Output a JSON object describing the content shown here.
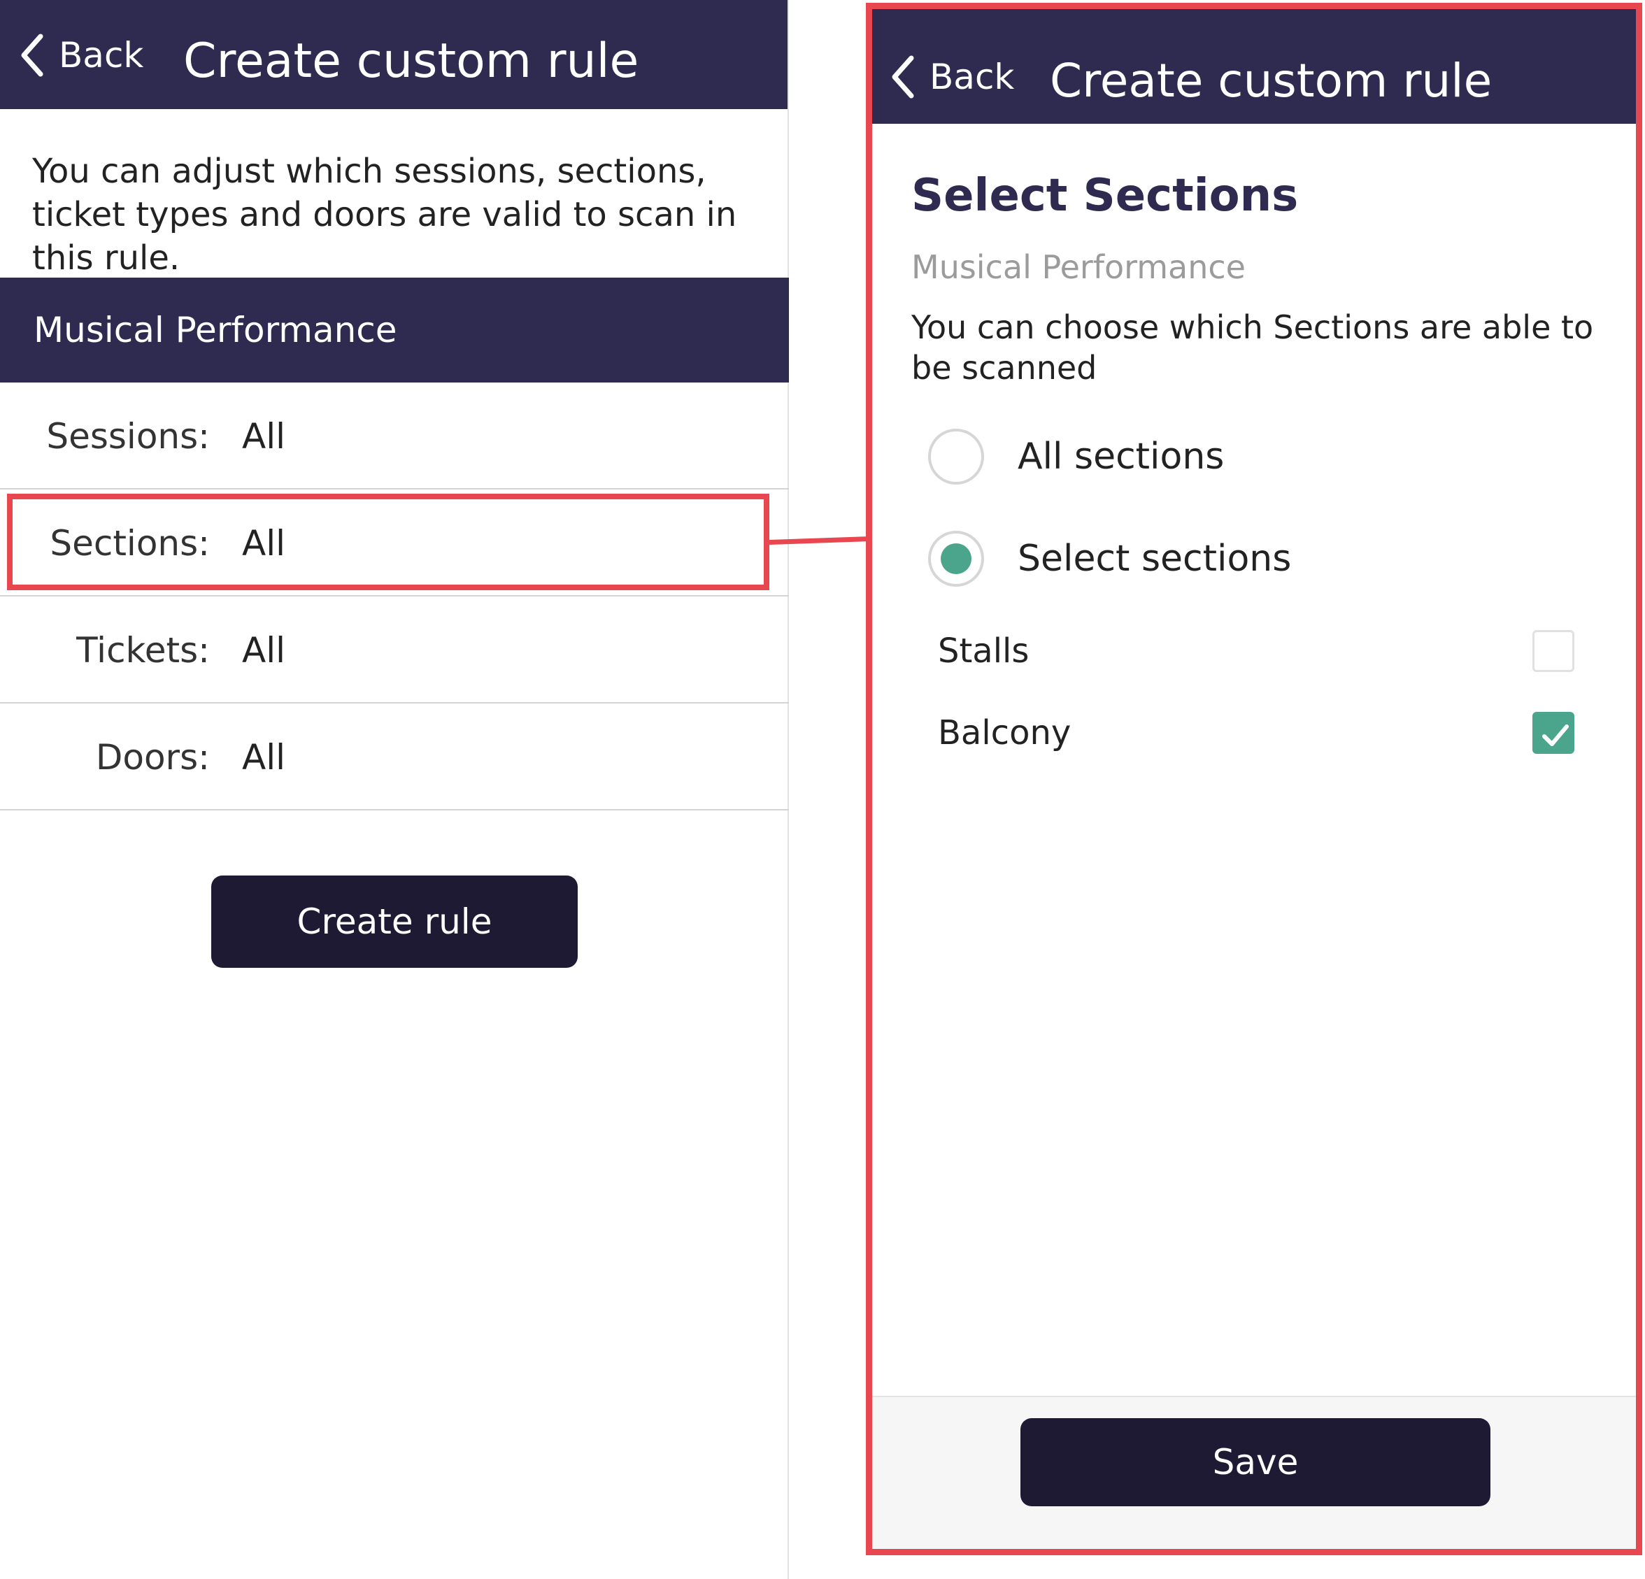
{
  "left_screen": {
    "header": {
      "back_label": "Back",
      "title": "Create custom rule"
    },
    "intro": "You can adjust which sessions, sections, ticket types and doors are valid to scan in this rule.",
    "section_header": "Musical Performance",
    "rows": [
      {
        "label": "Sessions:",
        "value": "All"
      },
      {
        "label": "Sections:",
        "value": "All"
      },
      {
        "label": "Tickets:",
        "value": "All"
      },
      {
        "label": "Doors:",
        "value": "All"
      }
    ],
    "create_button": "Create rule"
  },
  "right_screen": {
    "header": {
      "back_label": "Back",
      "title": "Create custom rule"
    },
    "title": "Select Sections",
    "subtitle": "Musical Performance",
    "description": "You can choose which Sections are able to be scanned",
    "radio_options": [
      {
        "label": "All sections",
        "selected": false
      },
      {
        "label": "Select sections",
        "selected": true
      }
    ],
    "sections": [
      {
        "label": "Stalls",
        "checked": false
      },
      {
        "label": "Balcony",
        "checked": true
      }
    ],
    "save_button": "Save"
  },
  "colors": {
    "header_bg": "#2f2a4f",
    "button_bg": "#1e1a33",
    "accent": "#4aa58c",
    "highlight": "#e9474f",
    "subtitle": "#9b9b9b"
  }
}
